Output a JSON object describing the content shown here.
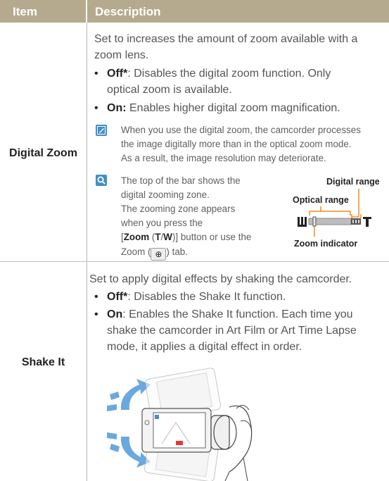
{
  "header": {
    "item": "Item",
    "description": "Description"
  },
  "rows": [
    {
      "item": "Digital Zoom",
      "intro_lines": [
        "Set to increases the amount of zoom available with a",
        "zoom lens."
      ],
      "bullets": [
        {
          "label": "Off*",
          "lines": [
            ": Disables the digital zoom function. Only",
            "optical zoom is available."
          ]
        },
        {
          "label": "On:",
          "lines": [
            " Enables higher digital zoom magnification."
          ]
        }
      ],
      "note_lines": [
        "When you use the digital zoom, the camcorder processes",
        "the image digitally more than in the optical zoom mode.",
        "As a result, the image resolution may deteriorate."
      ],
      "tip_lines": [
        "The top of the bar shows the",
        "digital zooming zone.",
        "The zooming zone appears",
        "when you press the"
      ],
      "tip_zoom": {
        "pre": "[",
        "word": "Zoom",
        "mid": " (",
        "t": "T",
        "slash": "/",
        "w": "W",
        "post": ")] button or use the"
      },
      "tip_last": {
        "pre": "Zoom (",
        "post": ") tab."
      },
      "diagram": {
        "digital_range": "Digital range",
        "optical_range": "Optical range",
        "zoom_indicator": "Zoom indicator",
        "wide": "W",
        "tele": "T"
      }
    },
    {
      "item": "Shake It",
      "intro_lines": [
        "Set to apply digital effects by shaking the camcorder."
      ],
      "bullets": [
        {
          "label": "Off*",
          "lines": [
            ": Disables the Shake It function."
          ]
        },
        {
          "label": "On",
          "lines": [
            ": Enables the Shake It function. Each time you",
            "shake the camcorder in Art Film or Art Time Lapse",
            "mode, it applies a digital effect in order."
          ]
        }
      ]
    }
  ],
  "colors": {
    "header_bg": "#b5aa8e",
    "accent_orange": "#f08a1e",
    "note_icon": "#3f8fca",
    "arrow_blue": "#6aa8e0"
  },
  "icons": {
    "note": "pencil-note-icon",
    "tip": "magnifier-tip-icon",
    "zoom_tab": "zoom-in-icon"
  }
}
